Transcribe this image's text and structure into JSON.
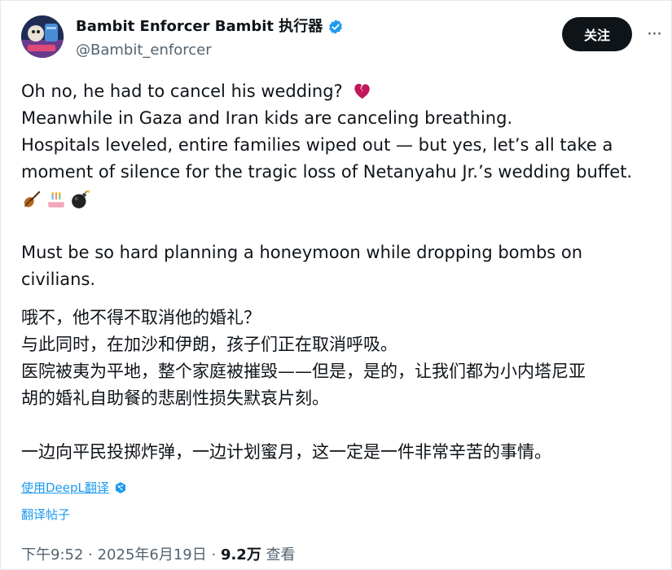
{
  "author": {
    "display_name": "Bambit Enforcer Bambit 执行器",
    "handle": "@Bambit_enforcer",
    "verified_icon": "verified-badge-icon"
  },
  "actions": {
    "follow_label": "关注",
    "more_label": "···"
  },
  "tweet": {
    "english_lines": [
      "Oh no, he had to cancel his wedding?",
      "Meanwhile in Gaza and Iran kids are canceling breathing.",
      "Hospitals leveled, entire families wiped out — but yes, let’s all take a",
      "moment of silence for the tragic loss of Netanyahu Jr.’s wedding buffet."
    ],
    "emojis": [
      "broken-heart-emoji",
      "violin-emoji",
      "birthday-cake-emoji",
      "bomb-emoji"
    ],
    "english_para2": [
      "Must be so hard planning a honeymoon while dropping bombs on",
      "civilians."
    ],
    "chinese_lines": [
      "哦不，他不得不取消他的婚礼？",
      "与此同时，在加沙和伊朗，孩子们正在取消呼吸。",
      "医院被夷为平地，整个家庭被摧毁——但是，是的，让我们都为小内塔尼亚",
      "胡的婚礼自助餐的悲剧性损失默哀片刻。"
    ],
    "chinese_para2": "一边向平民投掷炸弹，一边计划蜜月，这一定是一件非常辛苦的事情。"
  },
  "translation": {
    "deepl_label": "使用DeepL翻译",
    "translate_post_label": "翻译帖子"
  },
  "meta": {
    "time": "下午9:52",
    "separator": " · ",
    "date": "2025年6月19日",
    "views_count": "9.2万",
    "views_label": " 查看"
  },
  "colors": {
    "text": "#0f1419",
    "secondary": "#536471",
    "accent": "#1d9bf0",
    "button_bg": "#0f1419"
  }
}
